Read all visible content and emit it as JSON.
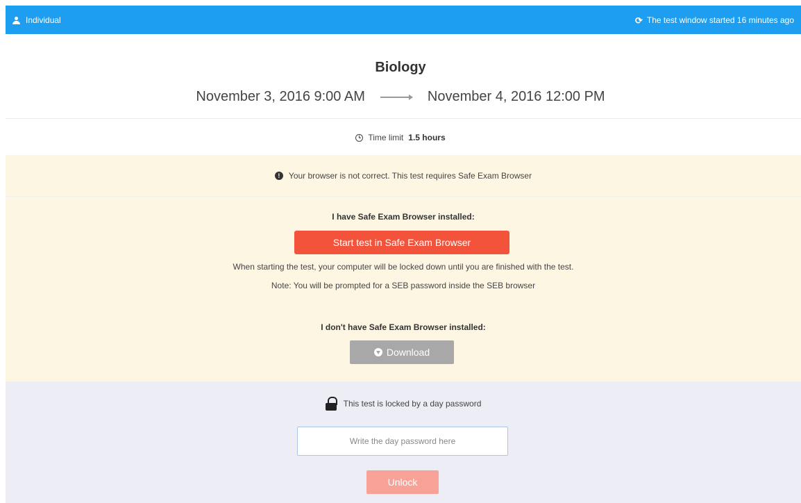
{
  "topbar": {
    "user_label": "Individual",
    "status_text": "The test window started 16 minutes ago",
    "background_color": "#1e9ef0"
  },
  "test": {
    "title": "Biology",
    "start": "November 3, 2016 9:00 AM",
    "end": "November 4, 2016 12:00 PM",
    "time_limit_label": "Time limit",
    "time_limit_value": "1.5 hours"
  },
  "warning": {
    "text": "Your browser is not correct. This test requires Safe Exam Browser"
  },
  "seb": {
    "installed_heading": "I have Safe Exam Browser installed:",
    "start_button": "Start test in Safe Exam Browser",
    "lock_note": "When starting the test, your computer will be locked down until you are finished with the test.",
    "password_note": "Note: You will be prompted for a SEB password inside the SEB browser",
    "not_installed_heading": "I don't have Safe Exam Browser installed:",
    "download_button": "Download"
  },
  "lock": {
    "text": "This test is locked by a day password",
    "input_placeholder": "Write the day password here",
    "input_value": "",
    "unlock_button": "Unlock"
  },
  "colors": {
    "accent": "#1e9ef0",
    "start_button": "#f4533b",
    "unlock_button": "#f8a196",
    "warning_bg": "#fdf6e3",
    "lock_panel_bg": "#ecedf5"
  }
}
